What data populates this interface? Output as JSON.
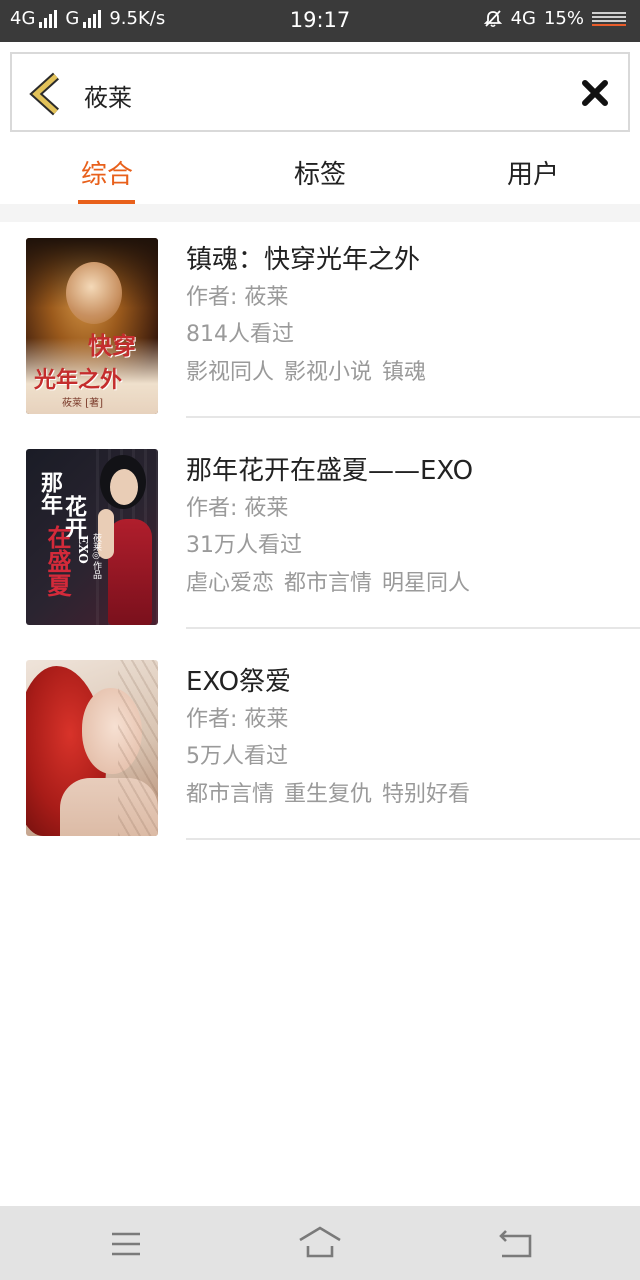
{
  "status_bar": {
    "network1": "4G",
    "network2": "G",
    "speed": "9.5K/s",
    "time": "19:17",
    "mobile_data": "4G",
    "battery": "15%",
    "icons": [
      "signal-icon",
      "mute-icon",
      "battery-icon"
    ]
  },
  "search": {
    "query": "莜莱",
    "back_icon": "chevron-left-icon",
    "clear_icon": "close-icon"
  },
  "tabs": [
    {
      "label": "综合",
      "active": true
    },
    {
      "label": "标签",
      "active": false
    },
    {
      "label": "用户",
      "active": false
    }
  ],
  "colors": {
    "accent": "#e8601b",
    "back_arrow": "#e2c25a",
    "status_bar": "#3a3a3a",
    "nav_bar": "#e3e3e3"
  },
  "books": [
    {
      "title": "镇魂：快穿光年之外",
      "author_label": "作者: 莜莱",
      "views": "814人看过",
      "tags": [
        "影视同人",
        "影视小说",
        "镇魂"
      ],
      "cover_text": [
        "快穿",
        "光年之外",
        "莜莱 [著]"
      ]
    },
    {
      "title": "那年花开在盛夏——EXO",
      "author_label": "作者: 莜莱",
      "views": "31万人看过",
      "tags": [
        "虐心爱恋",
        "都市言情",
        "明星同人"
      ],
      "cover_text": [
        "那年",
        "花开",
        "在盛夏",
        "EXO",
        "莜莱◎作品"
      ]
    },
    {
      "title": "EXO祭爱",
      "author_label": "作者: 莜莱",
      "views": "5万人看过",
      "tags": [
        "都市言情",
        "重生复仇",
        "特别好看"
      ],
      "cover_text": []
    }
  ],
  "nav": {
    "icons": [
      "menu-icon",
      "home-icon",
      "back-icon"
    ]
  }
}
